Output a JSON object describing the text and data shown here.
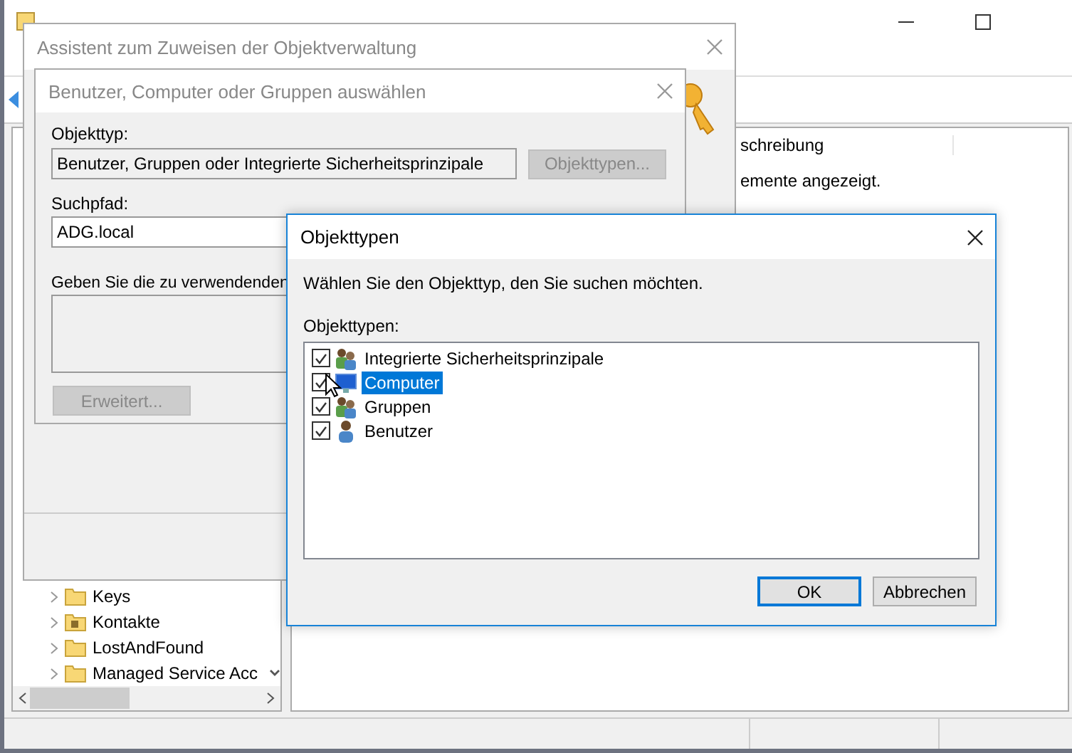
{
  "main_window": {
    "tree": {
      "items": [
        {
          "label": "Keys",
          "kind": "folder"
        },
        {
          "label": "Kontakte",
          "kind": "contacts-folder"
        },
        {
          "label": "LostAndFound",
          "kind": "folder"
        },
        {
          "label": "Managed Service Acc",
          "kind": "folder"
        }
      ]
    },
    "details": {
      "column_header": "schreibung",
      "message": "emente angezeigt."
    }
  },
  "wizard": {
    "title": "Assistent zum Zuweisen der Objektverwaltung"
  },
  "select_dialog": {
    "title": "Benutzer, Computer oder Gruppen auswählen",
    "object_type_label": "Objekttyp:",
    "object_type_value": "Benutzer, Gruppen oder Integrierte Sicherheitsprinzipale",
    "object_types_button": {
      "label": "Objekttypen...",
      "disabled": true
    },
    "path_label": "Suchpfad:",
    "path_value": "ADG.local",
    "names_label": "Geben Sie die zu verwendenden",
    "advanced_button": {
      "label": "Erweitert...",
      "disabled": true
    }
  },
  "object_types_dialog": {
    "title": "Objekttypen",
    "instruction": "Wählen Sie den Objekttyp, den Sie suchen möchten.",
    "list_label": "Objekttypen:",
    "items": [
      {
        "label": "Integrierte Sicherheitsprinzipale",
        "kind": "group",
        "checked": true,
        "selected": false
      },
      {
        "label": "Computer",
        "kind": "computer",
        "checked": true,
        "selected": true
      },
      {
        "label": "Gruppen",
        "kind": "group",
        "checked": true,
        "selected": false
      },
      {
        "label": "Benutzer",
        "kind": "user",
        "checked": true,
        "selected": false
      }
    ],
    "buttons": [
      {
        "label": "OK",
        "default": true
      },
      {
        "label": "Abbrechen",
        "default": false
      }
    ]
  }
}
